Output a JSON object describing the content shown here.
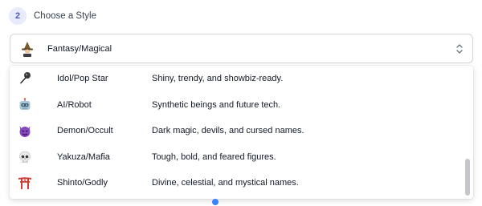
{
  "step": {
    "number": "2",
    "title": "Choose a Style"
  },
  "select": {
    "icon": "wizard-icon",
    "value": "Fantasy/Magical",
    "chevron": "up-down-chevron-icon"
  },
  "options": [
    {
      "icon": "microphone-icon",
      "name": "Idol/Pop Star",
      "description": "Shiny, trendy, and showbiz-ready."
    },
    {
      "icon": "robot-icon",
      "name": "AI/Robot",
      "description": "Synthetic beings and future tech."
    },
    {
      "icon": "devil-face-icon",
      "name": "Demon/Occult",
      "description": "Dark magic, devils, and cursed names."
    },
    {
      "icon": "skull-icon",
      "name": "Yakuza/Mafia",
      "description": "Tough, bold, and feared figures."
    },
    {
      "icon": "torii-gate-icon",
      "name": "Shinto/Godly",
      "description": "Divine, celestial, and mystical names."
    }
  ],
  "colors": {
    "accent": "#4b5bc4",
    "badge_bg": "#e7ebfb",
    "border": "#d1d5db"
  }
}
